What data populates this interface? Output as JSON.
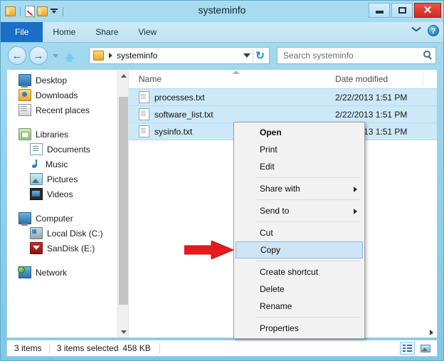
{
  "window": {
    "title": "systeminfo",
    "quick_access": [
      {
        "name": "folder-icon",
        "label": "Folder"
      },
      {
        "name": "properties-icon",
        "label": "Properties"
      },
      {
        "name": "new-folder-icon",
        "label": "New folder"
      },
      {
        "name": "customize-chevron-icon",
        "label": "Customize Quick Access Toolbar"
      }
    ],
    "controls": {
      "minimize": "Minimize",
      "maximize": "Maximize",
      "close": "✕",
      "close_label": "Close"
    },
    "colors": {
      "title_bar": "#93d2ec",
      "file_tab": "#1a6fc4",
      "close_button": "#cf2a20",
      "selection": "#cde8f7",
      "menu_highlight": "#cfe4f5",
      "arrow_red": "#e51b1b"
    }
  },
  "ribbon": {
    "tabs": [
      {
        "label": "File",
        "active": true
      },
      {
        "label": "Home",
        "active": false
      },
      {
        "label": "Share",
        "active": false
      },
      {
        "label": "View",
        "active": false
      }
    ],
    "expand_label": "Expand the Ribbon",
    "help_label": "?"
  },
  "address_bar": {
    "back_label": "←",
    "forward_label": "→",
    "recent_label": "Recent locations",
    "up_label": "Up one level",
    "path_separator": "▸",
    "path": "systeminfo",
    "dropdown_label": "Previous locations",
    "refresh_label": "↻"
  },
  "search": {
    "placeholder": "Search systeminfo",
    "icon": "search-icon"
  },
  "sidebar": {
    "items": [
      {
        "label": "Desktop",
        "icon": "desktop-icon",
        "indent": false
      },
      {
        "label": "Downloads",
        "icon": "downloads-icon",
        "indent": false
      },
      {
        "label": "Recent places",
        "icon": "recent-places-icon",
        "indent": false
      },
      {
        "label": "Libraries",
        "icon": "libraries-icon",
        "indent": false,
        "gap_before": true
      },
      {
        "label": "Documents",
        "icon": "documents-icon",
        "indent": true
      },
      {
        "label": "Music",
        "icon": "music-icon",
        "indent": true
      },
      {
        "label": "Pictures",
        "icon": "pictures-icon",
        "indent": true
      },
      {
        "label": "Videos",
        "icon": "videos-icon",
        "indent": true
      },
      {
        "label": "Computer",
        "icon": "computer-icon",
        "indent": false,
        "gap_before": true
      },
      {
        "label": "Local Disk (C:)",
        "icon": "local-disk-icon",
        "indent": true
      },
      {
        "label": "SanDisk (E:)",
        "icon": "sandisk-icon",
        "indent": true
      },
      {
        "label": "Network",
        "icon": "network-icon",
        "indent": false,
        "gap_before": true
      }
    ],
    "scroll_up_label": "Scroll up",
    "scroll_down_label": "Scroll down"
  },
  "file_list": {
    "columns": [
      {
        "label": "Name",
        "sorted": true
      },
      {
        "label": "Date modified",
        "sorted": false
      }
    ],
    "rows": [
      {
        "name": "processes.txt",
        "date": "2/22/2013 1:51 PM",
        "selected": true,
        "icon": "text-file-icon"
      },
      {
        "name": "software_list.txt",
        "date": "2/22/2013 1:51 PM",
        "selected": true,
        "icon": "text-file-icon"
      },
      {
        "name": "sysinfo.txt",
        "date": "2/22/2013 1:51 PM",
        "selected": true,
        "icon": "text-file-icon"
      }
    ],
    "scroll_right_label": "Scroll right"
  },
  "context_menu": {
    "items": [
      {
        "label": "Open",
        "bold": true,
        "submenu": false,
        "highlighted": false
      },
      {
        "label": "Print",
        "bold": false,
        "submenu": false,
        "highlighted": false
      },
      {
        "label": "Edit",
        "bold": false,
        "submenu": false,
        "highlighted": false
      },
      {
        "separator_after": true
      },
      {
        "label": "Share with",
        "bold": false,
        "submenu": true,
        "highlighted": false
      },
      {
        "separator_after": true
      },
      {
        "label": "Send to",
        "bold": false,
        "submenu": true,
        "highlighted": false
      },
      {
        "separator_after": true
      },
      {
        "label": "Cut",
        "bold": false,
        "submenu": false,
        "highlighted": false
      },
      {
        "label": "Copy",
        "bold": false,
        "submenu": false,
        "highlighted": true
      },
      {
        "separator_after": true
      },
      {
        "label": "Create shortcut",
        "bold": false,
        "submenu": false,
        "highlighted": false
      },
      {
        "label": "Delete",
        "bold": false,
        "submenu": false,
        "highlighted": false
      },
      {
        "label": "Rename",
        "bold": false,
        "submenu": false,
        "highlighted": false
      },
      {
        "separator_after": true
      },
      {
        "label": "Properties",
        "bold": false,
        "submenu": false,
        "highlighted": false
      }
    ]
  },
  "annotation": {
    "arrow_label": "red-arrow-pointing-to-copy"
  },
  "status_bar": {
    "item_count": "3 items",
    "selection_text": "3 items selected",
    "selection_size": "458 KB",
    "views": [
      {
        "label": "Details view",
        "icon": "details-view-icon",
        "active": true
      },
      {
        "label": "Large icons view",
        "icon": "large-icons-view-icon",
        "active": false
      }
    ]
  }
}
